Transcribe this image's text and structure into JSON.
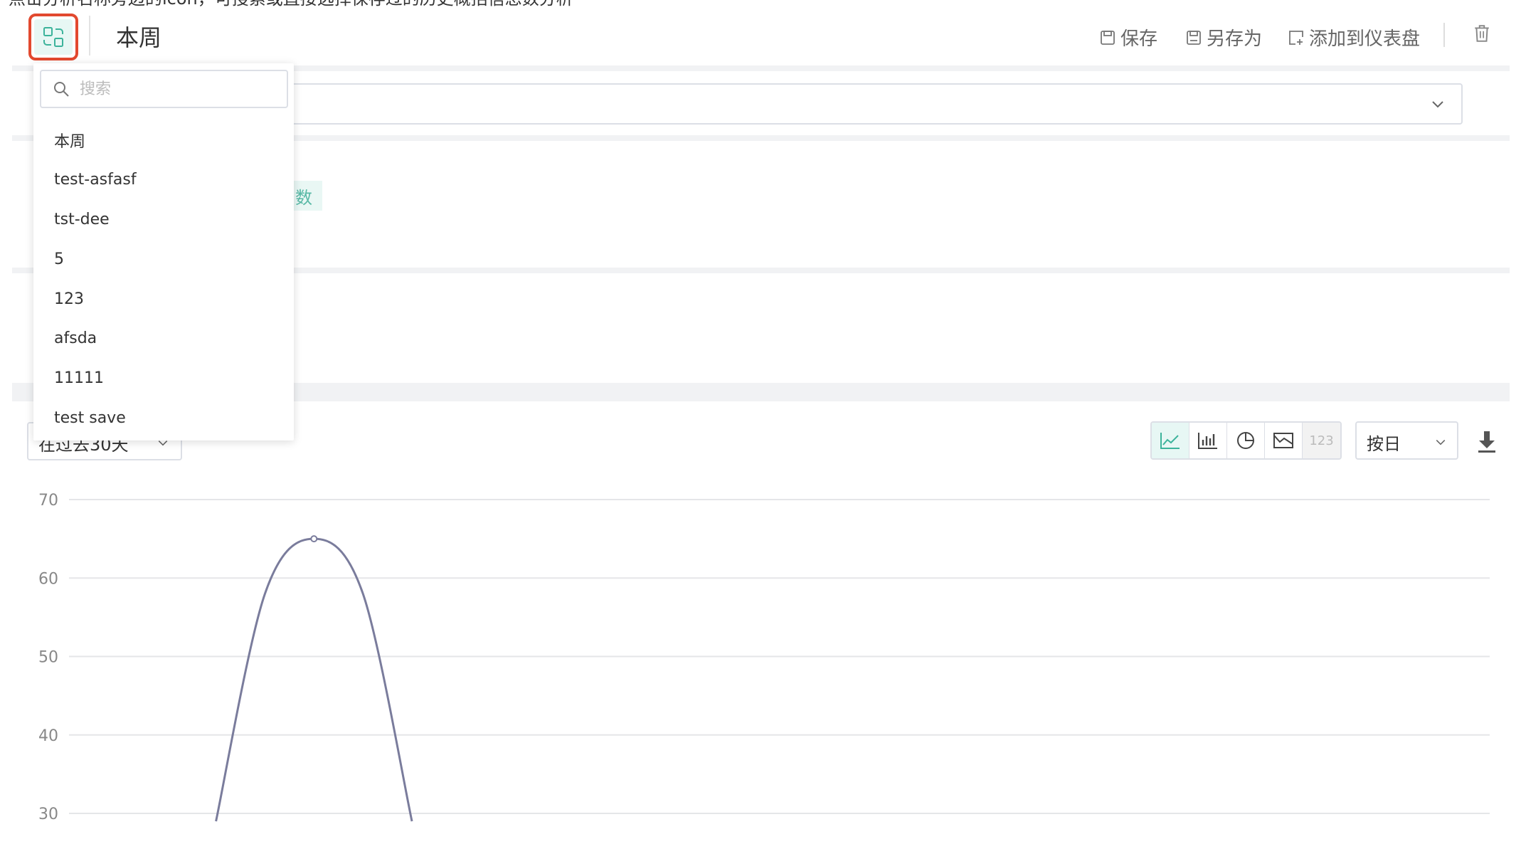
{
  "caption": "点击分析名称旁边的icon，可搜索或直接选择保存过的历史概括信息数分析",
  "header": {
    "title": "本周",
    "actions": {
      "save": "保存",
      "save_as": "另存为",
      "add_dashboard": "添加到仪表盘"
    }
  },
  "metric_tag": "数",
  "dropdown": {
    "search_placeholder": "搜索",
    "items": [
      "本周",
      "test-asfasf",
      "tst-dee",
      "5",
      "123",
      "afsda",
      "11111",
      "test save"
    ]
  },
  "toolbar": {
    "date_range": "在过去30天",
    "granularity": "按日",
    "number_type_label": "123"
  },
  "icons": [
    "switch-analysis-icon",
    "save-icon",
    "save-as-icon",
    "add-dashboard-icon",
    "trash-icon",
    "search-icon",
    "chevron-down-icon",
    "line-chart-icon",
    "bar-chart-icon",
    "pie-chart-icon",
    "area-chart-icon",
    "download-icon"
  ],
  "colors": {
    "accent": "#3cb39b",
    "highlight_border": "#e2492f",
    "series": "#7a7c9c"
  },
  "chart_data": {
    "type": "line",
    "y_ticks": [
      30,
      40,
      50,
      60,
      70
    ],
    "ylim": [
      30,
      70
    ],
    "xlim": [
      0,
      29
    ],
    "grid": true,
    "series": [
      {
        "x": [
          3,
          4,
          5,
          6,
          7
        ],
        "y": [
          29,
          58,
          65,
          58,
          29
        ]
      }
    ]
  }
}
